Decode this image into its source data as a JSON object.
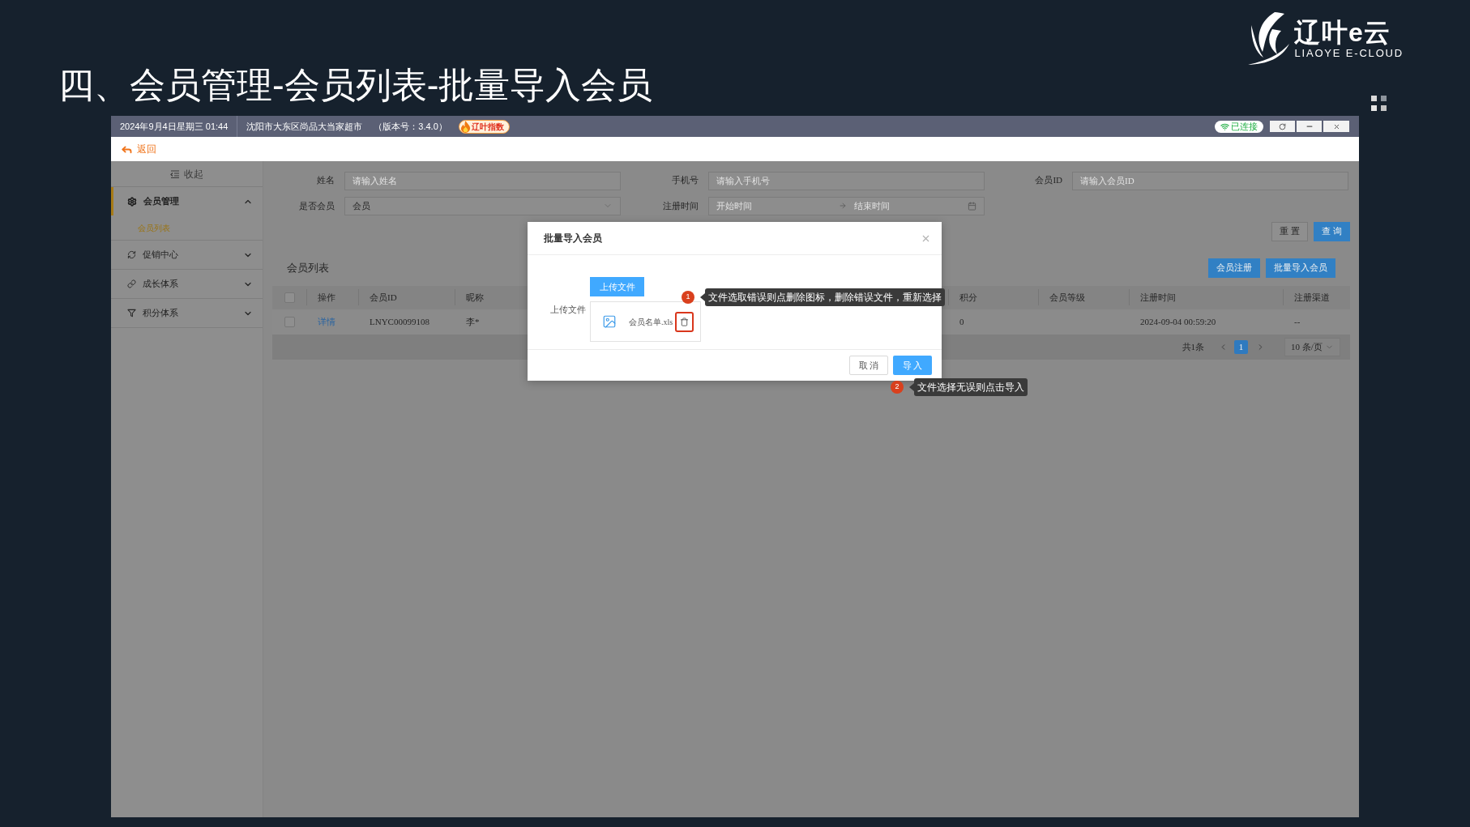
{
  "slide": {
    "title": "四、会员管理-会员列表-批量导入会员"
  },
  "logo": {
    "name": "辽叶e云",
    "tagline": "LIAOYE E-CLOUD"
  },
  "title_bar": {
    "datetime": "2024年9月4日星期三 01:44",
    "store": "沈阳市大东区尚品大当家超市",
    "version": "（版本号：3.4.0）",
    "badge": "辽叶指数",
    "connection": "已连接",
    "connected": true
  },
  "back_bar": {
    "label": "返回"
  },
  "sidebar": {
    "collapse": "收起",
    "items": [
      {
        "label": "会员管理",
        "selected": true,
        "expanded": true,
        "children": [
          {
            "label": "会员列表",
            "selected": true
          }
        ]
      },
      {
        "label": "促销中心",
        "selected": false,
        "expanded": false
      },
      {
        "label": "成长体系",
        "selected": false,
        "expanded": false
      },
      {
        "label": "积分体系",
        "selected": false,
        "expanded": false
      }
    ]
  },
  "filters": {
    "rows": [
      [
        {
          "kind": "input",
          "label": "姓名",
          "placeholder": "请输入姓名"
        },
        {
          "kind": "input",
          "label": "手机号",
          "placeholder": "请输入手机号"
        },
        {
          "kind": "input",
          "label": "会员ID",
          "placeholder": "请输入会员ID"
        }
      ],
      [
        {
          "kind": "select",
          "label": "是否会员",
          "value": "会员"
        },
        {
          "kind": "daterange",
          "label": "注册时间",
          "start_placeholder": "开始时间",
          "end_placeholder": "结束时间"
        }
      ]
    ],
    "buttons": [
      {
        "label": "重 置",
        "primary": false
      },
      {
        "label": "查 询",
        "primary": true
      }
    ]
  },
  "list": {
    "title": "会员列表",
    "buttons": [
      "会员注册",
      "批量导入会员"
    ]
  },
  "table": {
    "select_all_checked": false,
    "columns": [
      "操作",
      "会员ID",
      "昵称",
      "积分",
      "会员等级",
      "注册时间",
      "注册渠道"
    ],
    "rows": [
      {
        "checked": false,
        "action": "详情",
        "member_id": "LNYC00099108",
        "nickname": "李*",
        "points": "0",
        "registered_at": "2024-09-04 00:59:20",
        "channel": "--"
      }
    ]
  },
  "pagination": {
    "total": "共1条",
    "pages": [
      {
        "label": "1",
        "selected": true
      }
    ],
    "page_size": "10 条/页"
  },
  "dialog": {
    "title": "批量导入会员",
    "upload_button": "上传文件",
    "field_label": "上传文件",
    "file": {
      "name": "会员名单.xls",
      "highlighted": true
    },
    "buttons": [
      {
        "label": "取 消",
        "primary": false
      },
      {
        "label": "导 入",
        "primary": true
      }
    ]
  },
  "annotations": [
    {
      "number": "1",
      "text": "文件选取错误则点删除图标，删除错误文件，重新选择"
    },
    {
      "number": "2",
      "text": "文件选择无误则点击导入"
    }
  ]
}
